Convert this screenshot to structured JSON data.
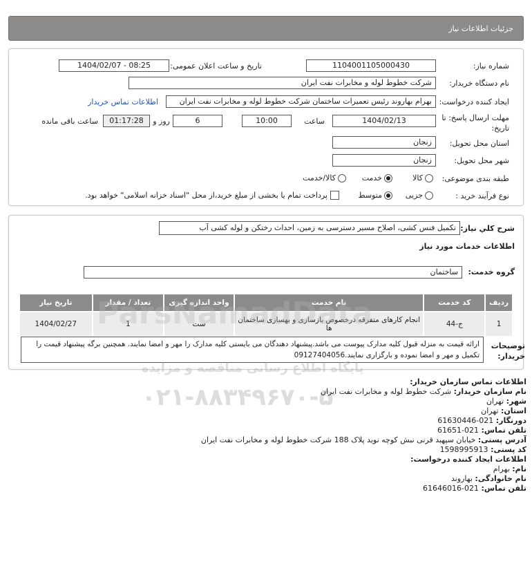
{
  "header": {
    "title": "جزئیات اطلاعات نیاز"
  },
  "form": {
    "need_number_label": "شماره نیاز:",
    "need_number": "1104001105000430",
    "announce_label": "تاریخ و ساعت اعلان عمومی:",
    "announce_value": "1404/02/07 - 08:25",
    "buyer_org_label": "نام دستگاه خریدار:",
    "buyer_org": "شرکت خطوط لوله و مخابرات نفت ایران",
    "creator_label": "ایجاد کننده درخواست:",
    "creator": "بهرام بهاروند رئیس تعمیرات ساختمان شرکت خطوط لوله و مخابرات نفت ایران",
    "buyer_contact_link": "اطلاعات تماس خریدار",
    "deadline_label_1": "مهلت ارسال پاسخ: تا",
    "deadline_label_2": "تاریخ:",
    "deadline_date": "1404/02/13",
    "hour_label": "ساعت",
    "deadline_time": "10:00",
    "days_value": "6",
    "days_label": "روز و",
    "remaining_time": "01:17:28",
    "remaining_label": "ساعت باقی مانده",
    "province_label": "استان محل تحویل:",
    "province": "زنجان",
    "city_label": "شهر محل تحویل:",
    "city": "زنجان",
    "category_label": "طبقه بندی موضوعی:",
    "category_options": [
      "کالا",
      "خدمت",
      "کالا/خدمت"
    ],
    "process_label": "نوع فرآیند خرید :",
    "process_options": [
      "جزیی",
      "متوسط"
    ],
    "payment_note": "پرداخت تمام یا بخشی از مبلغ خرید،از محل \"اسناد خزانه اسلامی\" خواهد بود."
  },
  "need": {
    "summary_label": "شرح کلي نياز:",
    "summary": "تکمیل فنس کشی، اصلاح مسیر دسترسی به زمین، احداث رختکن و لوله کشی آب",
    "services_title": "اطلاعات خدمات مورد نیاز",
    "service_group_label": "گروه خدمت:",
    "service_group": "ساختمان"
  },
  "table": {
    "headers": [
      "ردیف",
      "کد خدمت",
      "نام خدمت",
      "واحد اندازه گیری",
      "تعداد / مقدار",
      "تاریخ نیاز"
    ],
    "rows": [
      [
        "1",
        "ج-44",
        "انجام کارهای متفرقه درخصوص بازسازی و بهسازی ساختمان ها",
        "ست",
        "1",
        "1404/02/27"
      ]
    ]
  },
  "notes": {
    "label_1": "توضیحات",
    "label_2": "خریدار:",
    "text": "ارائه قیمت به منزله قبول کلیه مدارک پیوست می باشد.پیشنهاد دهندگان می بایستی کلیه مدارک را مهر و امضا نمایند. همچنین برگه پیشنهاد قیمت را تکمیل و مهر و امضا نموده و بارگزاری نمایند.09127404056"
  },
  "contact": {
    "title": "اطلاعات تماس سازمان خریدار:",
    "org_label": "نام سازمان خریدار:",
    "org": "شرکت خطوط لوله و مخابرات نفت ایران",
    "city_label": "شهر:",
    "city": "تهران",
    "province_label": "استان:",
    "province": "تهران",
    "fax_label": "دورنگار:",
    "fax": "021-61630446",
    "phone_label": "تلفن تماس:",
    "phone": "021-61651",
    "address_label": "آدرس پستی:",
    "address": "خیابان سپهبد قرنی نبش کوچه نوید پلاک 188 شرکت خطوط لوله و مخابرات نفت ایران",
    "postal_label": "کد پستی:",
    "postal": "1598995913",
    "creator_title": "اطلاعات ایجاد کننده درخواست:",
    "name_label": "نام:",
    "name": "بهرام",
    "family_label": "نام خانوادگی:",
    "family": "بهاروند",
    "creator_phone_label": "تلفن تماس:",
    "creator_phone": "021-61646016"
  },
  "watermark": {
    "brand": "ParsNamadData",
    "tagline": "پایگاه اطلاع رسانی مناقصه و مزایده",
    "phone": "۰۲۱-۸۸۳۴۹۶۷۰-۵"
  }
}
